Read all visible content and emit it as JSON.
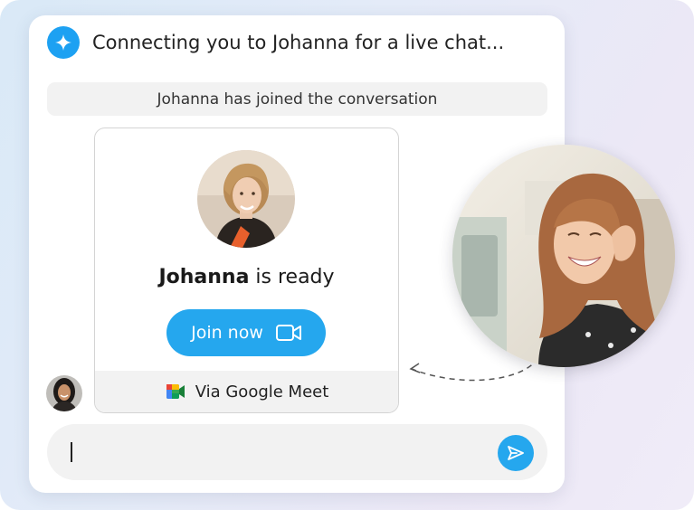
{
  "header": {
    "title": "Connecting you to Johanna for a live chat...",
    "icon": "sparkle-icon"
  },
  "system_notice": "Johanna has joined the conversation",
  "card": {
    "agent_name": "Johanna",
    "status_suffix": " is ready",
    "join_label": "Join now",
    "join_icon": "video-camera-icon",
    "footer_label": "Via Google Meet",
    "footer_icon": "google-meet-icon"
  },
  "composer": {
    "placeholder": "",
    "send_icon": "paper-plane-icon"
  },
  "colors": {
    "accent": "#25a7ee",
    "header_badge": "#1da1f2",
    "card_border": "#d4d4d4",
    "surface_gray": "#f2f2f2"
  }
}
